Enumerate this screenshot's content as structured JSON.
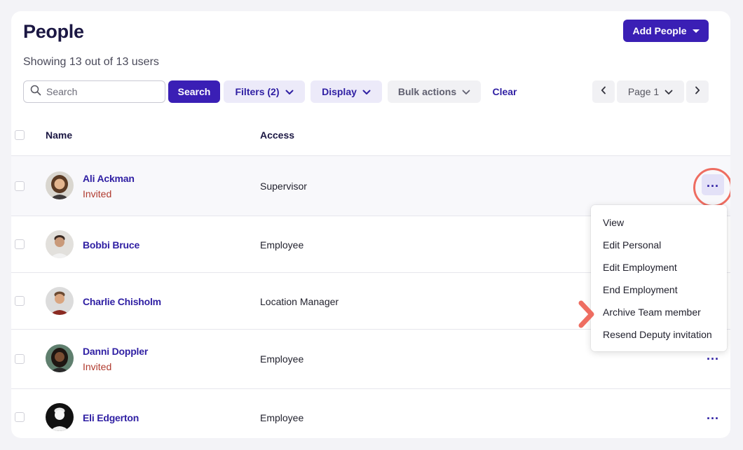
{
  "header": {
    "title": "People",
    "add_button_label": "Add People",
    "showing_text": "Showing 13 out of 13 users"
  },
  "toolbar": {
    "search_placeholder": "Search",
    "search_button": "Search",
    "filters_label": "Filters (2)",
    "display_label": "Display",
    "bulk_actions_label": "Bulk actions",
    "clear_label": "Clear",
    "page_label": "Page 1"
  },
  "table": {
    "columns": [
      "Name",
      "Access"
    ],
    "rows": [
      {
        "name": "Ali Ackman",
        "status": "Invited",
        "access": "Supervisor"
      },
      {
        "name": "Bobbi Bruce",
        "status": "",
        "access": "Employee"
      },
      {
        "name": "Charlie Chisholm",
        "status": "",
        "access": "Location Manager"
      },
      {
        "name": "Danni Doppler",
        "status": "Invited",
        "access": "Employee"
      },
      {
        "name": "Eli Edgerton",
        "status": "",
        "access": "Employee"
      }
    ]
  },
  "context_menu": {
    "items": [
      "View",
      "Edit Personal",
      "Edit Employment",
      "End Employment",
      "Archive Team member",
      "Resend Deputy invitation"
    ],
    "highlighted_item": "Archive Team member"
  },
  "colors": {
    "brand": "#3a1fb5",
    "link": "#2f1fa3",
    "invited": "#b03a2e",
    "annotation": "#ee6d61"
  },
  "icons": [
    "search-icon",
    "chevron-down-icon",
    "caret-down-icon",
    "chevron-left-icon",
    "chevron-right-icon",
    "more-horizontal-icon",
    "pointer-arrow-icon"
  ]
}
